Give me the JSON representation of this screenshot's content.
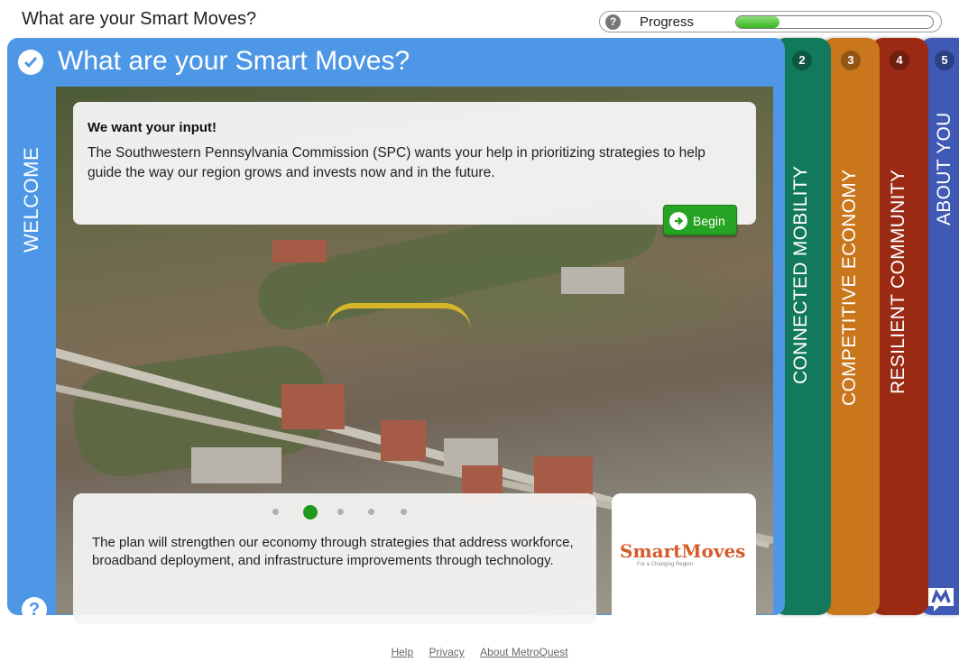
{
  "header": {
    "title": "What are your Smart Moves?",
    "help_glyph": "?",
    "progress_label": "Progress",
    "progress_fraction": 0.22
  },
  "panel": {
    "title": "What are your Smart Moves?",
    "welcome_tab": "WELCOME",
    "help_glyph": "?"
  },
  "intro": {
    "heading": "We want your input!",
    "body": "The Southwestern Pennsylvania Commission (SPC) wants your help in prioritizing strategies to help guide the way our region grows and invests now and in the future.",
    "begin_label": "Begin"
  },
  "carousel": {
    "total_slides": 5,
    "active_slide": 2,
    "caption": "The plan will strengthen our economy through strategies that address workforce, broadband deployment, and infrastructure improvements through technology."
  },
  "logo": {
    "text": "SmartMoves",
    "tagline": "For a Changing Region"
  },
  "steps": [
    {
      "number": "2",
      "label": "CONNECTED MOBILITY",
      "color": "#12795d"
    },
    {
      "number": "3",
      "label": "COMPETITIVE ECONOMY",
      "color": "#c9761c"
    },
    {
      "number": "4",
      "label": "RESILIENT COMMUNITY",
      "color": "#9b2a15"
    },
    {
      "number": "5",
      "label": "ABOUT YOU",
      "color": "#3f59b4"
    }
  ],
  "footer": {
    "links": [
      "Help",
      "Privacy",
      "About MetroQuest"
    ]
  },
  "colors": {
    "panel_blue": "#4e97e6",
    "begin_green": "#26a322",
    "progress_green": "#35b51f"
  }
}
